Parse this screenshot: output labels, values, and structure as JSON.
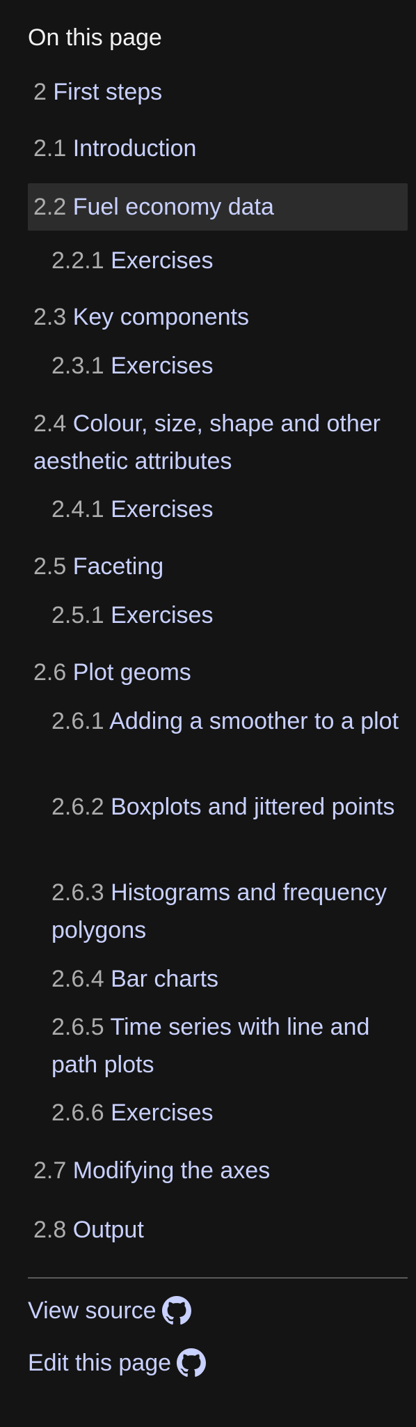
{
  "toc": {
    "heading": "On this page",
    "items": [
      {
        "num": "2",
        "title": "First steps"
      },
      {
        "num": "2.1",
        "title": "Introduction"
      },
      {
        "num": "2.2",
        "title": "Fuel economy data"
      },
      {
        "num": "2.2.1",
        "title": "Exercises"
      },
      {
        "num": "2.3",
        "title": "Key components"
      },
      {
        "num": "2.3.1",
        "title": "Exercises"
      },
      {
        "num": "2.4",
        "title": "Colour, size, shape and other aesthetic attributes"
      },
      {
        "num": "2.4.1",
        "title": "Exercises"
      },
      {
        "num": "2.5",
        "title": "Faceting"
      },
      {
        "num": "2.5.1",
        "title": "Exercises"
      },
      {
        "num": "2.6",
        "title": "Plot geoms"
      },
      {
        "num": "2.6.1",
        "title": "Adding a smoother to a plot"
      },
      {
        "num": "2.6.2",
        "title": "Boxplots and jittered points"
      },
      {
        "num": "2.6.3",
        "title": "Histograms and frequency polygons"
      },
      {
        "num": "2.6.4",
        "title": "Bar charts"
      },
      {
        "num": "2.6.5",
        "title": "Time series with line and path plots"
      },
      {
        "num": "2.6.6",
        "title": "Exercises"
      },
      {
        "num": "2.7",
        "title": "Modifying the axes"
      },
      {
        "num": "2.8",
        "title": "Output"
      }
    ]
  },
  "footer": {
    "view_source": "View source",
    "edit_page": "Edit this page",
    "icon": "github-icon"
  },
  "colors": {
    "background": "#141414",
    "link": "#c9d1ff",
    "number": "#adadad",
    "active_bg": "#2c2c2c"
  }
}
